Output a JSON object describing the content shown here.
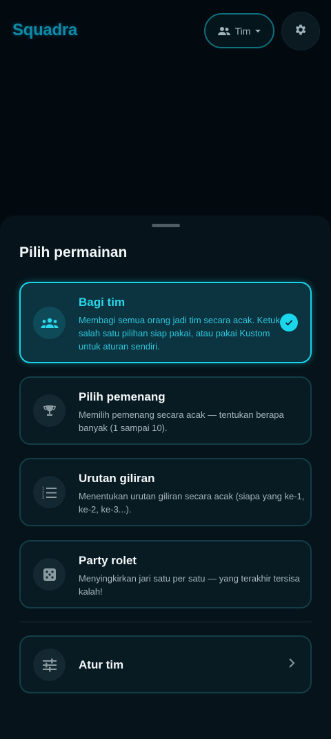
{
  "app": {
    "logo_text": "Squadra"
  },
  "header": {
    "mode_label": "Tim",
    "mode_icon": "group-icon",
    "settings_icon": "gear-icon"
  },
  "sheet": {
    "title": "Pilih permainan",
    "games": [
      {
        "id": "bagi-tim",
        "title": "Bagi tim",
        "description": "Membagi semua orang jadi tim secara acak. Ketuk salah satu pilihan siap pakai, atau pakai Kustom untuk aturan sendiri.",
        "icon": "groups-icon",
        "selected": true
      },
      {
        "id": "pilih-pemenang",
        "title": "Pilih pemenang",
        "description": "Memilih pemenang secara acak — tentukan berapa banyak (1 sampai 10).",
        "icon": "trophy-icon",
        "selected": false
      },
      {
        "id": "urutan-giliran",
        "title": "Urutan giliran",
        "description": "Menentukan urutan giliran secara acak (siapa yang ke-1, ke-2, ke-3...).",
        "icon": "numbered-list-icon",
        "selected": false
      },
      {
        "id": "party-rolet",
        "title": "Party rolet",
        "description": "Menyingkirkan jari satu per satu — yang terakhir tersisa kalah!",
        "icon": "dice-icon",
        "selected": false
      }
    ],
    "settings_row": {
      "title": "Atur tim",
      "icon": "tune-icon"
    }
  },
  "colors": {
    "accent": "#19d3e8",
    "logo": "#0e8aa8",
    "background": "#020a10",
    "sheet": "#06131a"
  }
}
